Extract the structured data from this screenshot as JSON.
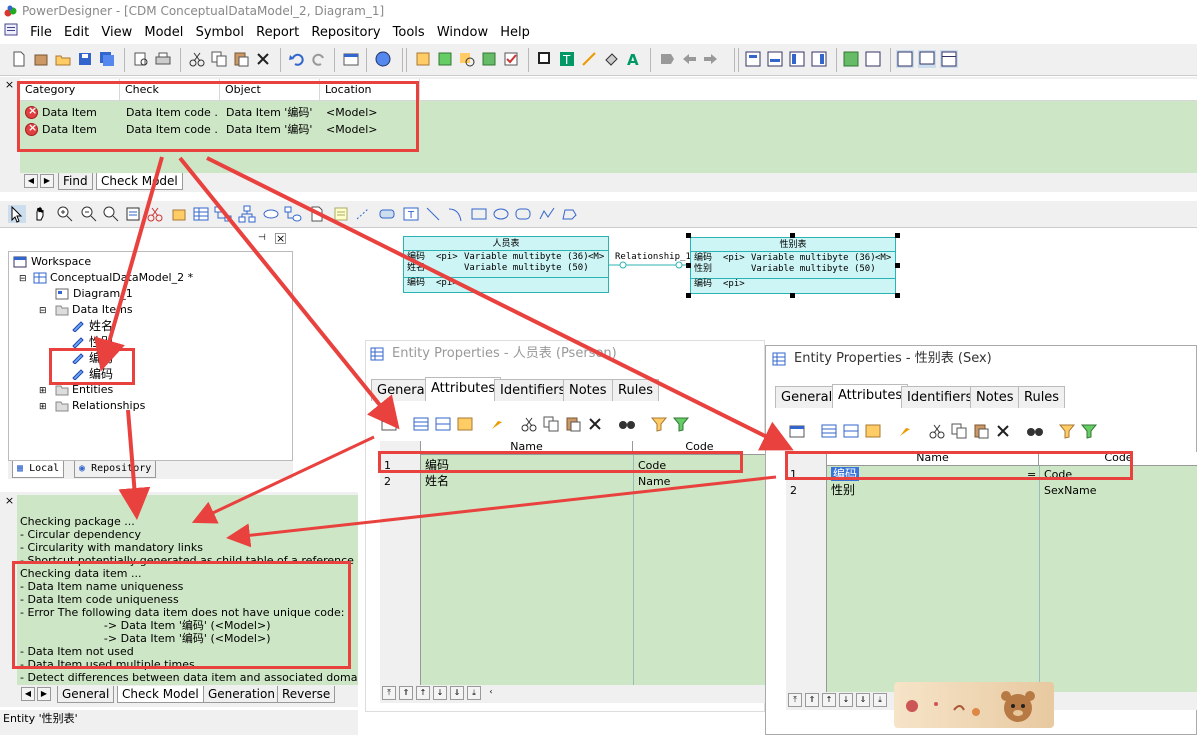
{
  "title": "PowerDesigner - [CDM ConceptualDataModel_2, Diagram_1]",
  "menu": [
    "File",
    "Edit",
    "View",
    "Model",
    "Symbol",
    "Report",
    "Repository",
    "Tools",
    "Window",
    "Help"
  ],
  "result_list": {
    "headers": [
      "Category",
      "Check",
      "Object",
      "Location"
    ],
    "rows": [
      {
        "category": "Data Item",
        "check": "Data Item code ...",
        "object": "Data Item '编码'",
        "location": "<Model>"
      },
      {
        "category": "Data Item",
        "check": "Data Item code ...",
        "object": "Data Item '编码'",
        "location": "<Model>"
      }
    ],
    "tabs": [
      "Find",
      "Check Model"
    ]
  },
  "browser": {
    "workspace": "Workspace",
    "model": "ConceptualDataModel_2 *",
    "diagram": "Diagram_1",
    "data_items_folder": "Data Items",
    "items": [
      "姓名",
      "性别",
      "编码",
      "编码"
    ],
    "entities": "Entities",
    "relationships": "Relationships",
    "tabs": [
      "Local",
      "Repository"
    ]
  },
  "output": {
    "lines": [
      "Checking package ...",
      "-     Circular dependency",
      "-     Circularity with mandatory links",
      "-     Shortcut potentially generated as child table of a reference",
      "Checking data item ...",
      "-     Data Item name uniqueness",
      "-     Data Item code uniqueness",
      "-     Error           The following data item does not have unique code:",
      "                        -> Data Item '编码' (<Model>)",
      "                        -> Data Item '编码' (<Model>)",
      "-     Data Item not used",
      "-     Data Item used multiple times",
      "-     Detect differences between data item and associated domain"
    ],
    "tabs": [
      "General",
      "Check Model",
      "Generation",
      "Reverse"
    ]
  },
  "diagram": {
    "entity1": {
      "name": "人员表",
      "rows": [
        {
          "a": "编码",
          "b": "<pi>",
          "c": "Variable multibyte (36)",
          "d": "<M>"
        },
        {
          "a": "姓名",
          "b": "",
          "c": "Variable multibyte (50)",
          "d": ""
        }
      ],
      "key": {
        "a": "编码",
        "b": "<pi>"
      }
    },
    "relationship": "Relationship_1",
    "entity2": {
      "name": "性别表",
      "rows": [
        {
          "a": "编码",
          "b": "<pi>",
          "c": "Variable multibyte (36)",
          "d": "<M>"
        },
        {
          "a": "性别",
          "b": "",
          "c": "Variable multibyte (50)",
          "d": ""
        }
      ],
      "key": {
        "a": "编码",
        "b": "<pi>"
      }
    }
  },
  "props1": {
    "title": "Entity Properties - 人员表 (Pserson)",
    "tabs": [
      "General",
      "Attributes",
      "Identifiers",
      "Notes",
      "Rules"
    ],
    "headers": [
      "Name",
      "Code"
    ],
    "rows": [
      {
        "n": "1",
        "name": "编码",
        "code": "Code"
      },
      {
        "n": "2",
        "name": "姓名",
        "code": "Name"
      }
    ]
  },
  "props2": {
    "title": "Entity Properties - 性别表 (Sex)",
    "tabs": [
      "General",
      "Attributes",
      "Identifiers",
      "Notes",
      "Rules"
    ],
    "headers": [
      "Name",
      "Code"
    ],
    "rows": [
      {
        "n": "1",
        "name": "编码",
        "eq": "=",
        "code": "Code"
      },
      {
        "n": "2",
        "name": "性别",
        "eq": "",
        "code": "SexName"
      }
    ]
  },
  "status": "Entity '性别表'",
  "colors": {
    "grid_green": "#cde6c5",
    "highlight_red": "#e8413e",
    "entity_fill": "#cdf5f5"
  }
}
